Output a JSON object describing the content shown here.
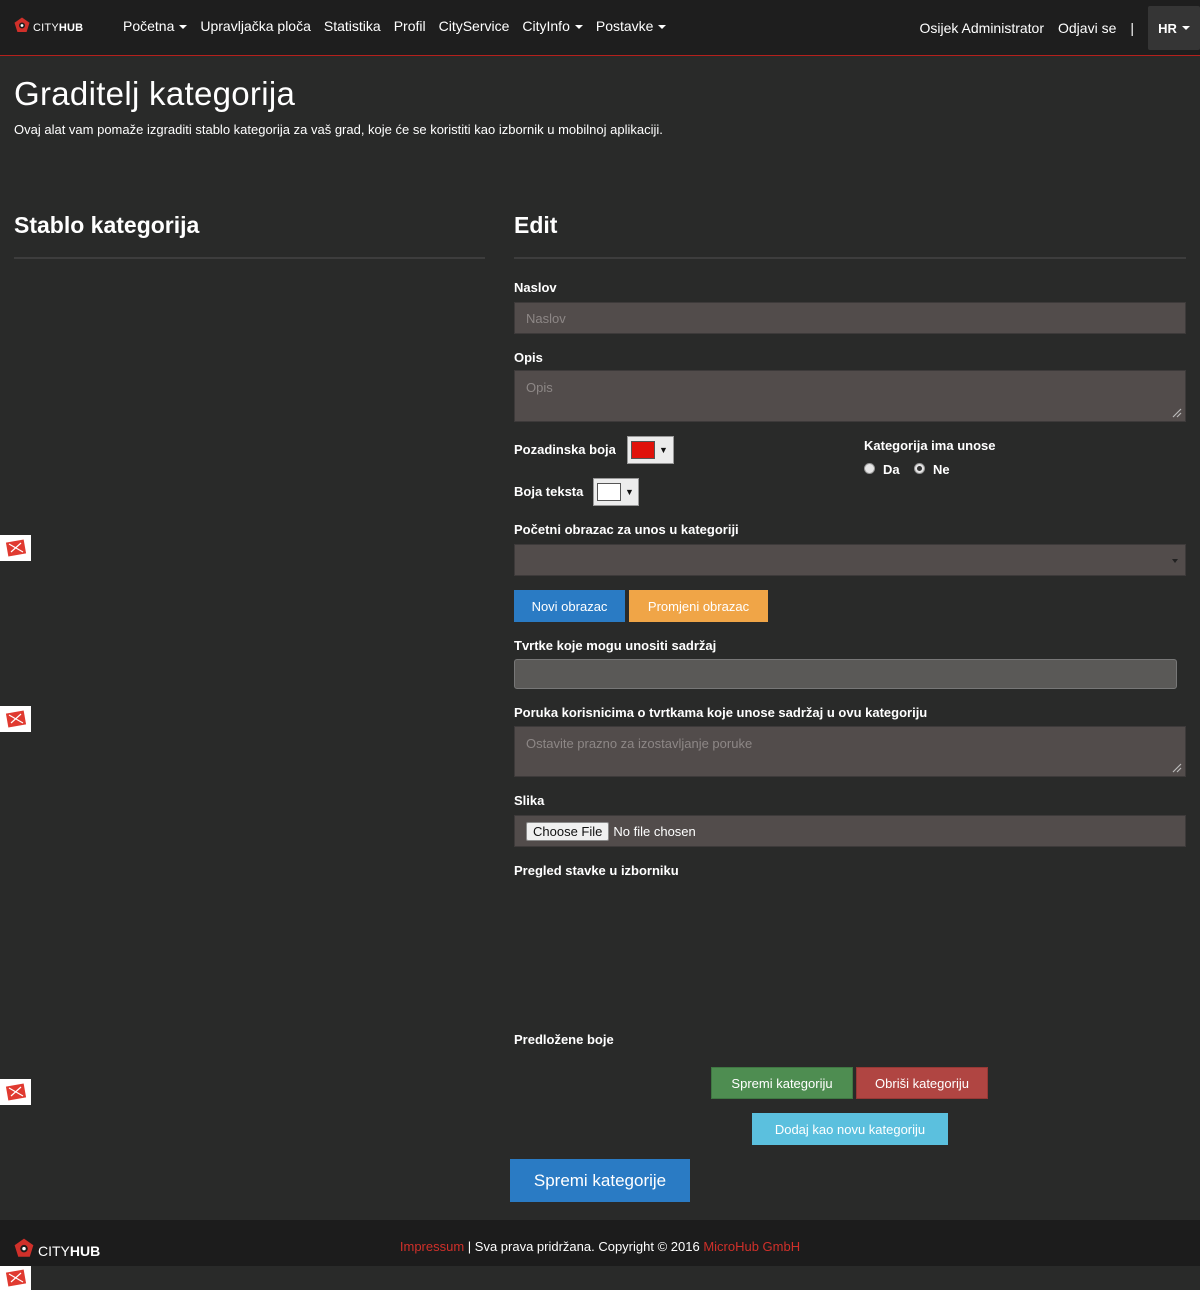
{
  "navbar": {
    "brand_city": "CITY",
    "brand_hub": "HUB",
    "items": [
      {
        "label": "Početna",
        "dropdown": true
      },
      {
        "label": "Upravljačka ploča",
        "dropdown": false
      },
      {
        "label": "Statistika",
        "dropdown": false
      },
      {
        "label": "Profil",
        "dropdown": false
      },
      {
        "label": "CityService",
        "dropdown": false
      },
      {
        "label": "CityInfo",
        "dropdown": true
      },
      {
        "label": "Postavke",
        "dropdown": true
      }
    ],
    "user": "Osijek Administrator",
    "logout": "Odjavi se",
    "separator": "|",
    "language": "HR"
  },
  "page": {
    "title": "Graditelj kategorija",
    "description": "Ovaj alat vam pomaže izgraditi stablo kategorija za vaš grad, koje će se koristiti kao izbornik u mobilnoj aplikaciji."
  },
  "tree": {
    "heading": "Stablo kategorija"
  },
  "edit": {
    "heading": "Edit",
    "title_label": "Naslov",
    "title_placeholder": "Naslov",
    "desc_label": "Opis",
    "desc_placeholder": "Opis",
    "bg_color_label": "Pozadinska boja",
    "bg_color_value": "#e0120b",
    "text_color_label": "Boja teksta",
    "text_color_value": "#ffffff",
    "has_entries_label": "Kategorija ima unose",
    "has_entries_yes": "Da",
    "has_entries_no": "Ne",
    "has_entries_selected": "Ne",
    "initial_form_label": "Početni obrazac za unos u kategoriji",
    "initial_form_value": "",
    "new_form_button": "Novi obrazac",
    "change_form_button": "Promjeni obrazac",
    "companies_label": "Tvrtke koje mogu unositi sadržaj",
    "message_label": "Poruka korisnicima o tvrtkama koje unose sadržaj u ovu kategoriju",
    "message_placeholder": "Ostavite prazno za izostavljanje poruke",
    "image_label": "Slika",
    "choose_file": "Choose File",
    "no_file": "No file chosen",
    "preview_label": "Pregled stavke u izborniku",
    "suggested_colors_label": "Predložene boje",
    "save_category": "Spremi kategoriju",
    "delete_category": "Obriši kategoriju",
    "add_new_category": "Dodaj kao novu kategoriju"
  },
  "save_categories": "Spremi kategorije",
  "footer": {
    "brand_city": "CITY",
    "brand_hub": "HUB",
    "impressum": "Impressum",
    "rights": " | Sva prava pridržana. Copyright © 2016 ",
    "company": "MicroHub GmbH"
  },
  "colors": {
    "accent_red": "#d0302a",
    "primary_blue": "#2a7bc4",
    "warning_orange": "#f0a547",
    "success_green": "#4e8d51",
    "danger_red": "#b04542",
    "info_cyan": "#5bc0de"
  }
}
